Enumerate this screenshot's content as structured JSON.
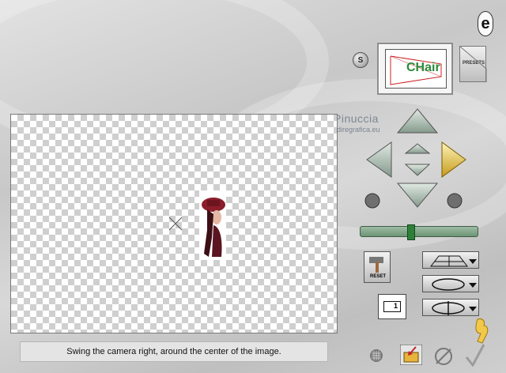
{
  "watermark": {
    "name": "Pinuccia",
    "url": "www.maidiregrafica.eu"
  },
  "preview": {
    "text": "CHair"
  },
  "buttons": {
    "s_label": "S",
    "presets_label": "PRESETS",
    "reset_label": "RESET",
    "help_label": "e",
    "frame_label": "1"
  },
  "slider": {
    "value": 0.42
  },
  "status": {
    "text": "Swing the camera right, around the center of the image."
  },
  "colors": {
    "arrow": "#a9bfb1",
    "arrow_active": "#e6c24a",
    "slider": "#7aa183"
  }
}
